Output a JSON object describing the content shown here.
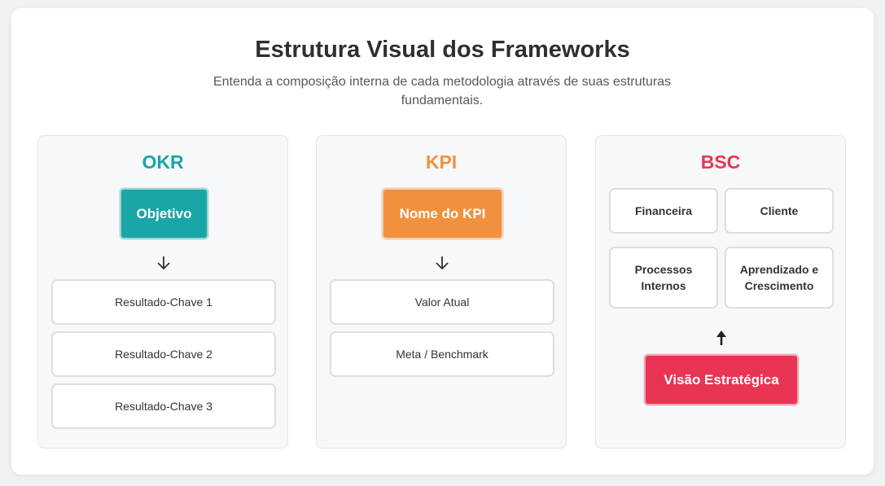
{
  "header": {
    "title": "Estrutura Visual dos Frameworks",
    "subtitle": "Entenda a composição interna de cada metodologia através de suas estruturas fundamentais."
  },
  "colors": {
    "okr": "#1aa6a6",
    "kpi": "#f2913d",
    "bsc": "#e83553"
  },
  "okr": {
    "title": "OKR",
    "main_label": "Objetivo",
    "arrow_icon": "arrow-down-icon",
    "items": [
      "Resultado-Chave 1",
      "Resultado-Chave 2",
      "Resultado-Chave 3"
    ]
  },
  "kpi": {
    "title": "KPI",
    "main_label": "Nome do KPI",
    "arrow_icon": "arrow-down-icon",
    "items": [
      "Valor Atual",
      "Meta / Benchmark"
    ]
  },
  "bsc": {
    "title": "BSC",
    "perspectives": [
      "Financeira",
      "Cliente",
      "Processos Internos",
      "Aprendizado e Crescimento"
    ],
    "arrow_icon": "arrow-up-icon",
    "main_label": "Visão Estratégica"
  }
}
